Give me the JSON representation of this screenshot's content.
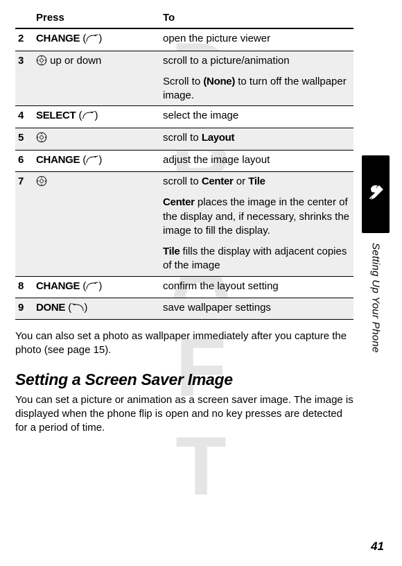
{
  "watermark": "DRAFT",
  "table": {
    "head_press": "Press",
    "head_to": "To",
    "rows": [
      {
        "num": "2",
        "action_key": "CHANGE",
        "action_softkey": "right",
        "desc": "open the picture viewer",
        "grey": false,
        "rule": true
      },
      {
        "num": "3",
        "nav": "up or down",
        "desc": "scroll to a picture/animation",
        "desc2a": "Scroll to ",
        "desc2bold": "(None)",
        "desc2b": " to turn off the wallpaper image.",
        "grey": true,
        "rule": true
      },
      {
        "num": "4",
        "action_key": "SELECT",
        "action_softkey": "right",
        "desc": "select the image",
        "grey": false,
        "rule": true
      },
      {
        "num": "5",
        "nav": "",
        "desc_pre": "scroll to ",
        "desc_bold": "Layout",
        "grey": true,
        "rule": true
      },
      {
        "num": "6",
        "action_key": "CHANGE",
        "action_softkey": "right",
        "desc": "adjust the image layout",
        "grey": false,
        "rule": true
      },
      {
        "num": "7",
        "nav": "",
        "desc_pre": "scroll to ",
        "desc_bold": "Center",
        "desc_mid": " or ",
        "desc_bold2": "Tile",
        "center_b": "Center",
        "center_t": " places the image in the center of the display and, if necessary, shrinks the image to fill the display.",
        "tile_b": "Tile",
        "tile_t": " fills the display with adjacent copies of the image",
        "grey": true,
        "rule": true
      },
      {
        "num": "8",
        "action_key": "CHANGE",
        "action_softkey": "right",
        "desc": "confirm the layout setting",
        "grey": false,
        "rule": true
      },
      {
        "num": "9",
        "action_key": "DONE",
        "action_softkey": "left",
        "desc": "save wallpaper settings",
        "grey": true,
        "rule": true
      }
    ]
  },
  "body_para1": "You can also set a photo as wallpaper immediately after you capture the photo (see page 15).",
  "heading": "Setting a Screen Saver Image",
  "body_para2": "You can set a picture or animation as a screen saver image. The image is displayed when the phone flip is open and no key presses are detected for a period of time.",
  "side_label": "Setting Up Your Phone",
  "page_number": "41",
  "chart_data": {
    "type": "table",
    "note": "instruction-step table, no numeric chart data"
  }
}
